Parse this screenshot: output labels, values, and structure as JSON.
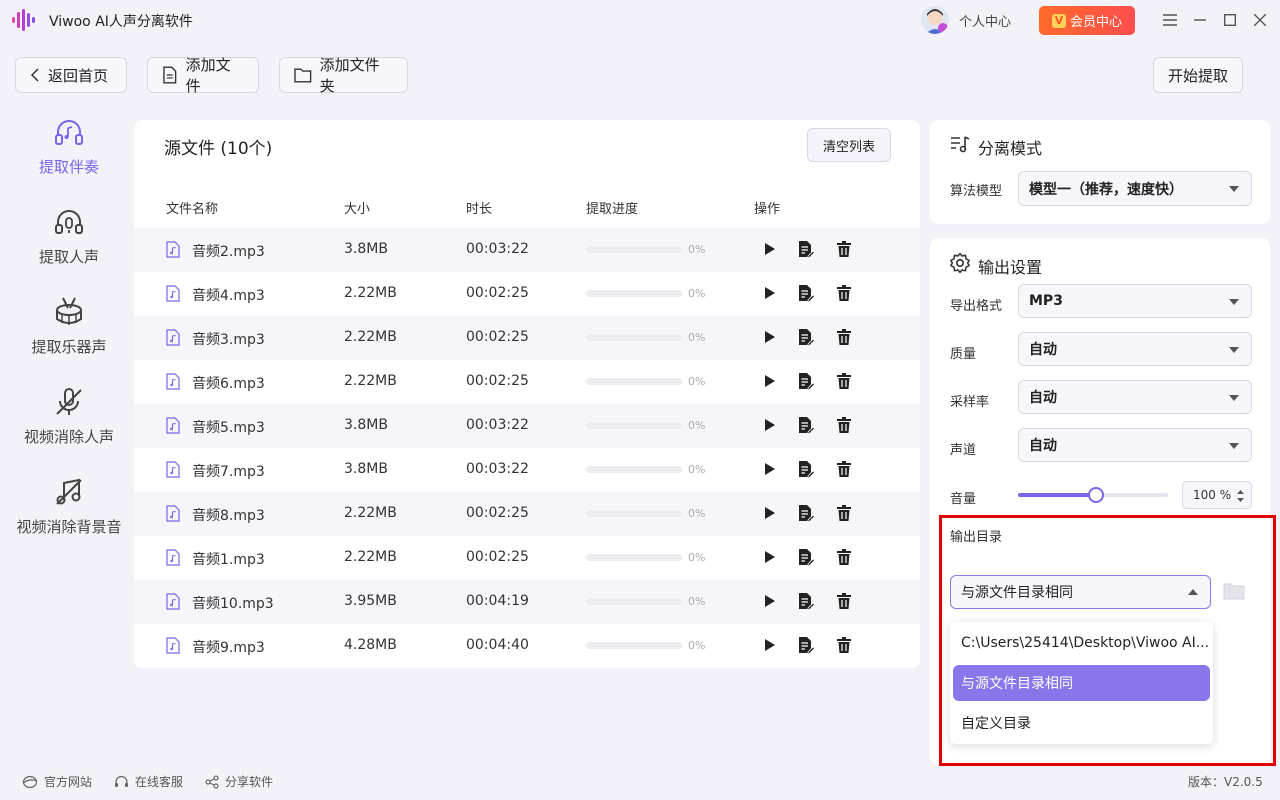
{
  "app": {
    "title": "Viwoo AI人声分离软件",
    "user_center": "个人中心",
    "vip_label": "会员中心",
    "vip_badge": "V",
    "accent_color": "#7c63ea"
  },
  "toolbar": {
    "back_label": "返回首页",
    "add_file_label": "添加文件",
    "add_folder_label": "添加文件夹",
    "start_label": "开始提取"
  },
  "sidebar": {
    "items": [
      {
        "label": "提取伴奏",
        "icon": "headphones-music-icon",
        "active": true
      },
      {
        "label": "提取人声",
        "icon": "headset-mic-icon",
        "active": false
      },
      {
        "label": "提取乐器声",
        "icon": "drum-icon",
        "active": false
      },
      {
        "label": "视频消除人声",
        "icon": "mic-off-icon",
        "active": false
      },
      {
        "label": "视频消除背景音",
        "icon": "music-off-icon",
        "active": false
      }
    ]
  },
  "files": {
    "title": "源文件 (10个)",
    "clear_label": "清空列表",
    "columns": [
      "文件名称",
      "大小",
      "时长",
      "提取进度",
      "操作"
    ],
    "rows": [
      {
        "name": "音频2.mp3",
        "size": "3.8MB",
        "duration": "00:03:22",
        "progress": "0%"
      },
      {
        "name": "音频4.mp3",
        "size": "2.22MB",
        "duration": "00:02:25",
        "progress": "0%"
      },
      {
        "name": "音频3.mp3",
        "size": "2.22MB",
        "duration": "00:02:25",
        "progress": "0%"
      },
      {
        "name": "音频6.mp3",
        "size": "2.22MB",
        "duration": "00:02:25",
        "progress": "0%"
      },
      {
        "name": "音频5.mp3",
        "size": "3.8MB",
        "duration": "00:03:22",
        "progress": "0%"
      },
      {
        "name": "音频7.mp3",
        "size": "3.8MB",
        "duration": "00:03:22",
        "progress": "0%"
      },
      {
        "name": "音频8.mp3",
        "size": "2.22MB",
        "duration": "00:02:25",
        "progress": "0%"
      },
      {
        "name": "音频1.mp3",
        "size": "2.22MB",
        "duration": "00:02:25",
        "progress": "0%"
      },
      {
        "name": "音频10.mp3",
        "size": "3.95MB",
        "duration": "00:04:19",
        "progress": "0%"
      },
      {
        "name": "音频9.mp3",
        "size": "4.28MB",
        "duration": "00:04:40",
        "progress": "0%"
      }
    ]
  },
  "separation": {
    "title": "分离模式",
    "model_label": "算法模型",
    "model_value": "模型一（推荐，速度快）"
  },
  "output": {
    "title": "输出设置",
    "format_label": "导出格式",
    "format_value": "MP3",
    "quality_label": "质量",
    "quality_value": "自动",
    "samplerate_label": "采样率",
    "samplerate_value": "自动",
    "channel_label": "声道",
    "channel_value": "自动",
    "volume_label": "音量",
    "volume_value": "100 %",
    "volume_fraction": 0.52,
    "dir_label": "输出目录",
    "dir_value": "与源文件目录相同",
    "dir_options": [
      "C:\\Users\\25414\\Desktop\\Viwoo AI...",
      "与源文件目录相同",
      "自定义目录"
    ],
    "dir_selected_index": 1
  },
  "footer": {
    "website": "官方网站",
    "support": "在线客服",
    "share": "分享软件",
    "version": "版本：V2.0.5"
  }
}
